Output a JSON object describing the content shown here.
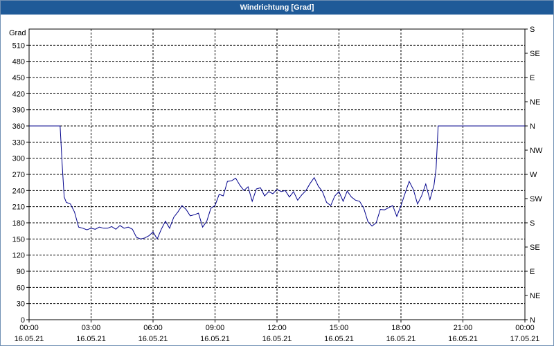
{
  "window": {
    "title": "Windrichtung [Grad]"
  },
  "chart_data": {
    "type": "line",
    "title": "Windrichtung [Grad]",
    "ylabel": "Grad",
    "ylim": [
      0,
      540
    ],
    "y_ticks": [
      0,
      30,
      60,
      90,
      120,
      150,
      180,
      210,
      240,
      270,
      300,
      330,
      360,
      390,
      420,
      450,
      480,
      510
    ],
    "right_ticks": [
      {
        "value": 0,
        "label": "N"
      },
      {
        "value": 45,
        "label": "NE"
      },
      {
        "value": 90,
        "label": "E"
      },
      {
        "value": 135,
        "label": "SE"
      },
      {
        "value": 180,
        "label": "S"
      },
      {
        "value": 225,
        "label": "SW"
      },
      {
        "value": 270,
        "label": "W"
      },
      {
        "value": 315,
        "label": "NW"
      },
      {
        "value": 360,
        "label": "N"
      },
      {
        "value": 405,
        "label": "NE"
      },
      {
        "value": 450,
        "label": "E"
      },
      {
        "value": 495,
        "label": "SE"
      },
      {
        "value": 540,
        "label": "S"
      }
    ],
    "xlim_hours": [
      0,
      24
    ],
    "x_ticks": [
      {
        "hour": 0,
        "time": "00:00",
        "date": "16.05.21"
      },
      {
        "hour": 3,
        "time": "03:00",
        "date": "16.05.21"
      },
      {
        "hour": 6,
        "time": "06:00",
        "date": "16.05.21"
      },
      {
        "hour": 9,
        "time": "09:00",
        "date": "16.05.21"
      },
      {
        "hour": 12,
        "time": "12:00",
        "date": "16.05.21"
      },
      {
        "hour": 15,
        "time": "15:00",
        "date": "16.05.21"
      },
      {
        "hour": 18,
        "time": "18:00",
        "date": "16.05.21"
      },
      {
        "hour": 21,
        "time": "21:00",
        "date": "16.05.21"
      },
      {
        "hour": 24,
        "time": "00:00",
        "date": "17.05.21"
      }
    ],
    "grid": true,
    "line_color": "#00008b",
    "series": [
      {
        "x": [
          0,
          1.5,
          1.6,
          1.7,
          1.8,
          2.0,
          2.2,
          2.4,
          2.6,
          2.8,
          3.0,
          3.2,
          3.4,
          3.6,
          3.8,
          4.0,
          4.2,
          4.4,
          4.6,
          4.8,
          5.0,
          5.2,
          5.4,
          5.6,
          5.8,
          6.0,
          6.2,
          6.4,
          6.6,
          6.8,
          7.0,
          7.2,
          7.4,
          7.6,
          7.8,
          8.0,
          8.2,
          8.4,
          8.6,
          8.8,
          9.0,
          9.2,
          9.4,
          9.6,
          9.8,
          10.0,
          10.2,
          10.4,
          10.6,
          10.8,
          11.0,
          11.2,
          11.4,
          11.6,
          11.8,
          12.0,
          12.2,
          12.4,
          12.6,
          12.8,
          13.0,
          13.2,
          13.4,
          13.6,
          13.8,
          14.0,
          14.2,
          14.4,
          14.6,
          14.8,
          15.0,
          15.2,
          15.4,
          15.6,
          15.8,
          16.0,
          16.2,
          16.4,
          16.6,
          16.8,
          17.0,
          17.2,
          17.4,
          17.6,
          17.8,
          18.0,
          18.2,
          18.4,
          18.6,
          18.8,
          19.0,
          19.2,
          19.4,
          19.6,
          19.7,
          19.8,
          24
        ],
        "y": [
          360,
          360,
          290,
          228,
          218,
          215,
          200,
          172,
          170,
          167,
          170,
          168,
          172,
          170,
          170,
          173,
          168,
          175,
          170,
          172,
          168,
          153,
          150,
          152,
          156,
          163,
          150,
          168,
          183,
          170,
          190,
          200,
          212,
          205,
          193,
          195,
          198,
          172,
          183,
          207,
          212,
          233,
          230,
          257,
          258,
          263,
          250,
          240,
          247,
          220,
          243,
          245,
          230,
          238,
          234,
          242,
          238,
          240,
          228,
          238,
          222,
          232,
          240,
          253,
          264,
          248,
          238,
          218,
          212,
          230,
          238,
          220,
          239,
          228,
          222,
          220,
          207,
          182,
          174,
          180,
          205,
          204,
          208,
          212,
          192,
          212,
          235,
          257,
          242,
          215,
          230,
          252,
          223,
          250,
          280,
          360,
          360
        ]
      }
    ]
  }
}
